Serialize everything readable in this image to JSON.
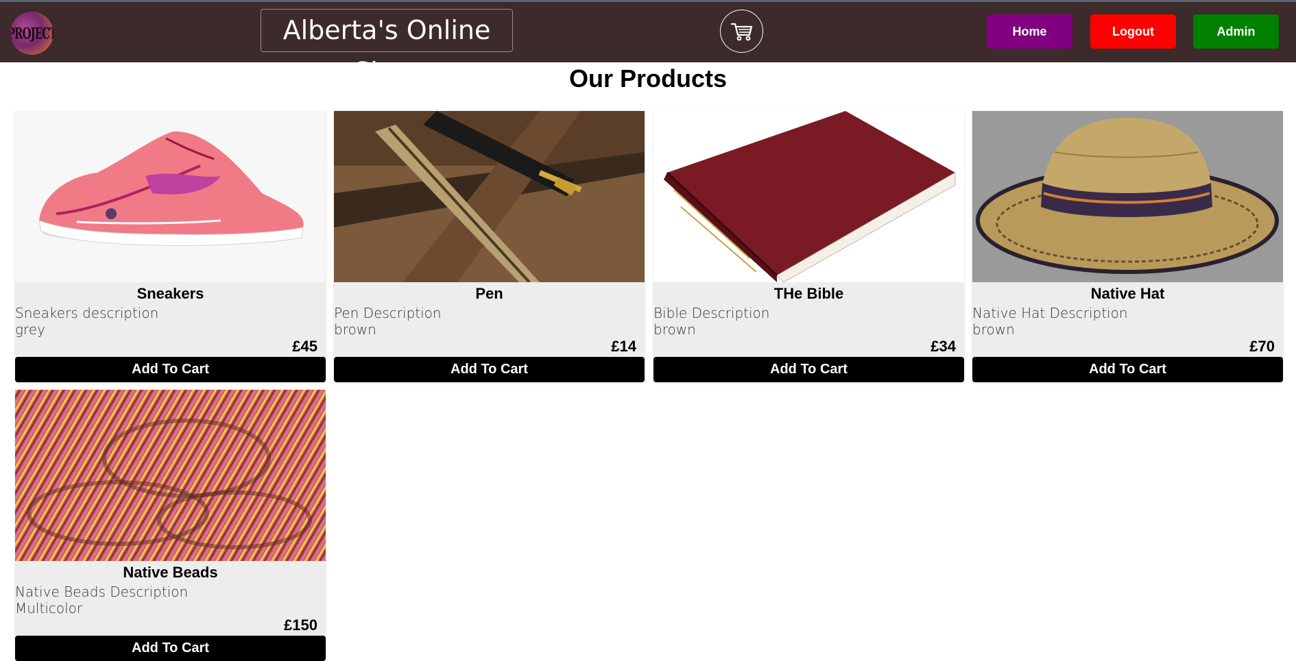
{
  "header": {
    "logo_text": "PROJECT",
    "shop_title": "Alberta's Online Shop",
    "cart_icon": "cart-icon",
    "nav": {
      "home": "Home",
      "logout": "Logout",
      "admin": "Admin"
    },
    "colors": {
      "bar": "#3d2a2a",
      "home": "#800080",
      "logout": "#ff0000",
      "admin": "#008000"
    }
  },
  "main": {
    "heading": "Our Products",
    "button_label": "Add To Cart",
    "products": [
      {
        "name": "Sneakers",
        "description": "Sneakers description",
        "color": "grey",
        "price": "£45"
      },
      {
        "name": "Pen",
        "description": "Pen Description",
        "color": "brown",
        "price": "£14"
      },
      {
        "name": "THe Bible",
        "description": "Bible Description",
        "color": "brown",
        "price": "£34"
      },
      {
        "name": "Native Hat",
        "description": "Native Hat Description",
        "color": "brown",
        "price": "£70"
      },
      {
        "name": "Native Beads",
        "description": "Native Beads Description",
        "color": "Multicolor",
        "price": "£150"
      }
    ]
  }
}
